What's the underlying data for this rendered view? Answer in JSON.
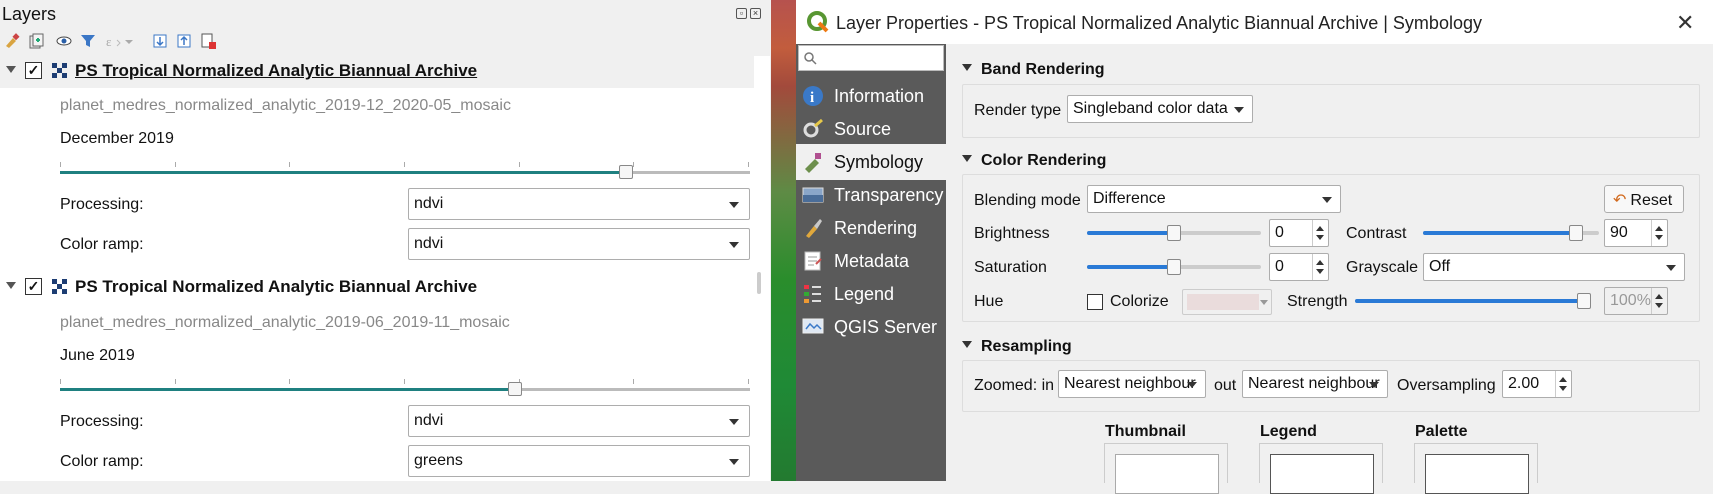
{
  "layers_panel": {
    "title": "Layers",
    "groups": [
      {
        "title": "PS Tropical Normalized Analytic Biannual Archive",
        "checked": true,
        "mosaic": "planet_medres_normalized_analytic_2019-12_2020-05_mosaic",
        "date": "December 2019",
        "slider_fraction": 0.82,
        "processing_label": "Processing:",
        "processing_value": "ndvi",
        "color_ramp_label": "Color ramp:",
        "color_ramp_value": "ndvi"
      },
      {
        "title": "PS Tropical Normalized Analytic Biannual Archive",
        "checked": true,
        "mosaic": "planet_medres_normalized_analytic_2019-06_2019-11_mosaic",
        "date": "June 2019",
        "slider_fraction": 0.66,
        "processing_label": "Processing:",
        "processing_value": "ndvi",
        "color_ramp_label": "Color ramp:",
        "color_ramp_value": "greens"
      }
    ]
  },
  "dialog": {
    "title": "Layer Properties - PS Tropical Normalized Analytic Biannual Archive | Symbology",
    "sidebar": [
      {
        "label": "Information",
        "icon": "info-icon"
      },
      {
        "label": "Source",
        "icon": "source-icon"
      },
      {
        "label": "Symbology",
        "icon": "symbology-icon",
        "selected": true
      },
      {
        "label": "Transparency",
        "icon": "transparency-icon"
      },
      {
        "label": "Rendering",
        "icon": "rendering-icon"
      },
      {
        "label": "Metadata",
        "icon": "metadata-icon"
      },
      {
        "label": "Legend",
        "icon": "legend-icon"
      },
      {
        "label": "QGIS Server",
        "icon": "qgis-server-icon"
      }
    ],
    "band_rendering": {
      "header": "Band Rendering",
      "render_type_label": "Render type",
      "render_type_value": "Singleband color data"
    },
    "color_rendering": {
      "header": "Color Rendering",
      "blending_label": "Blending mode",
      "blending_value": "Difference",
      "reset_label": "Reset",
      "brightness_label": "Brightness",
      "brightness_value": "0",
      "brightness_fraction": 0.5,
      "contrast_label": "Contrast",
      "contrast_value": "90",
      "contrast_fraction": 0.9,
      "saturation_label": "Saturation",
      "saturation_value": "0",
      "saturation_fraction": 0.5,
      "grayscale_label": "Grayscale",
      "grayscale_value": "Off",
      "hue_label": "Hue",
      "colorize_label": "Colorize",
      "strength_label": "Strength",
      "strength_value": "100%",
      "strength_fraction": 1.0
    },
    "resampling": {
      "header": "Resampling",
      "zoomed_in_label": "Zoomed: in",
      "zoomed_in_value": "Nearest neighbour",
      "out_label": "out",
      "out_value": "Nearest neighbour",
      "oversampling_label": "Oversampling",
      "oversampling_value": "2.00"
    },
    "previews": {
      "thumbnail": "Thumbnail",
      "legend": "Legend",
      "palette": "Palette"
    }
  }
}
